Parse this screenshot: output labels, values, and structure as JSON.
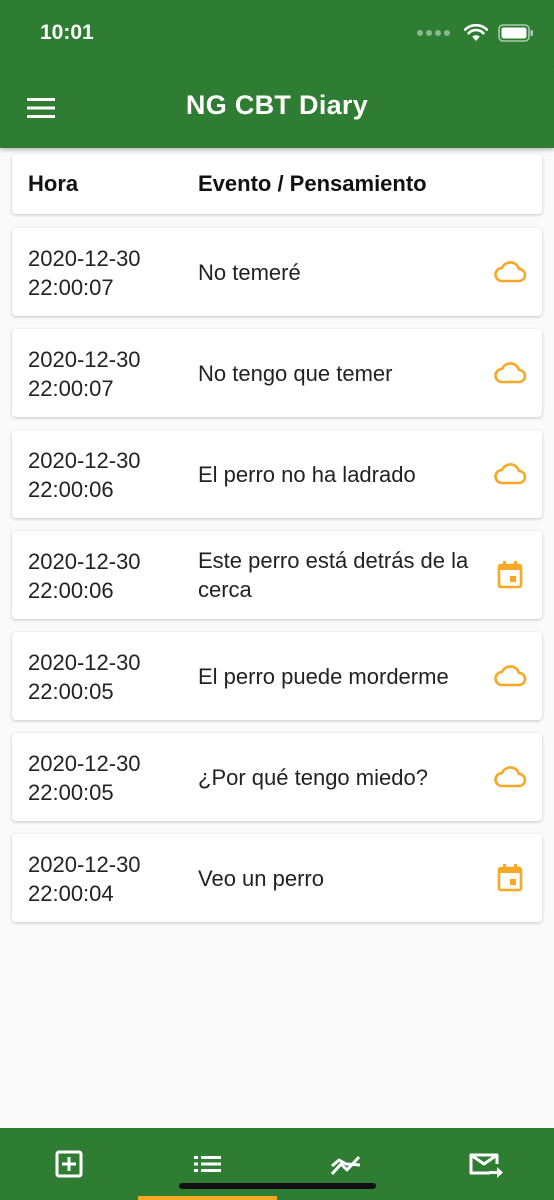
{
  "status_bar": {
    "time": "10:01"
  },
  "app_bar": {
    "title": "NG CBT Diary",
    "menu_icon": "hamburger-menu-icon"
  },
  "table": {
    "headers": [
      "Hora",
      "Evento / Pensamiento"
    ],
    "rows": [
      {
        "date": "2020-12-30",
        "time": "22:00:07",
        "text": "No temeré",
        "icon": "cloud-icon"
      },
      {
        "date": "2020-12-30",
        "time": "22:00:07",
        "text": "No tengo que temer",
        "icon": "cloud-icon"
      },
      {
        "date": "2020-12-30",
        "time": "22:00:06",
        "text": "El perro no ha ladrado",
        "icon": "cloud-icon"
      },
      {
        "date": "2020-12-30",
        "time": "22:00:06",
        "text": "Este perro está detrás de la cerca",
        "icon": "calendar-icon"
      },
      {
        "date": "2020-12-30",
        "time": "22:00:05",
        "text": "El perro puede morderme",
        "icon": "cloud-icon"
      },
      {
        "date": "2020-12-30",
        "time": "22:00:05",
        "text": "¿Por qué tengo miedo?",
        "icon": "cloud-icon"
      },
      {
        "date": "2020-12-30",
        "time": "22:00:04",
        "text": "Veo un perro",
        "icon": "calendar-icon"
      }
    ]
  },
  "bottom_nav": {
    "items": [
      {
        "icon": "add-box-icon",
        "selected": false
      },
      {
        "icon": "list-icon",
        "selected": true
      },
      {
        "icon": "trend-chart-icon",
        "selected": false
      },
      {
        "icon": "export-mail-icon",
        "selected": false
      }
    ]
  },
  "colors": {
    "primary": "#2e7d32",
    "accent": "#f9a825",
    "background": "#fafafa",
    "card": "#ffffff"
  }
}
